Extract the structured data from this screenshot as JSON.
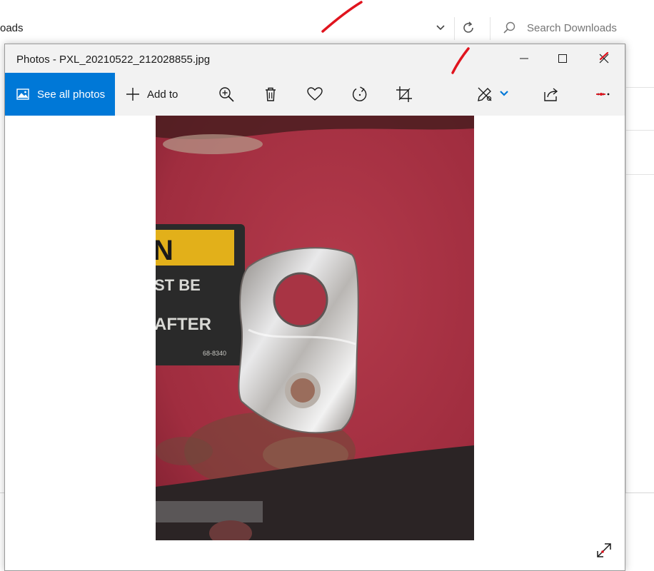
{
  "explorer": {
    "path_fragment": "oads",
    "search_placeholder": "Search Downloads",
    "icons": [
      "chevron-down-icon",
      "refresh-icon",
      "search-icon"
    ]
  },
  "photos": {
    "title": "Photos - PXL_20210522_212028855.jpg",
    "toolbar": {
      "see_all_label": "See all photos",
      "add_to_label": "Add to",
      "icons": [
        "zoom-in-icon",
        "delete-icon",
        "favorite-icon",
        "rotate-icon",
        "crop-icon",
        "edit-draw-icon",
        "share-icon",
        "more-icon"
      ]
    },
    "window_controls": [
      "minimize-icon",
      "maximize-icon",
      "close-icon"
    ],
    "image": {
      "sticker_line1": "N",
      "sticker_line2": "ST BE",
      "sticker_line3": "AFTER",
      "sticker_code": "68-8340"
    }
  },
  "colors": {
    "accent": "#0078d7",
    "annotation": "#e0141e",
    "surface_red": "#a83040"
  }
}
